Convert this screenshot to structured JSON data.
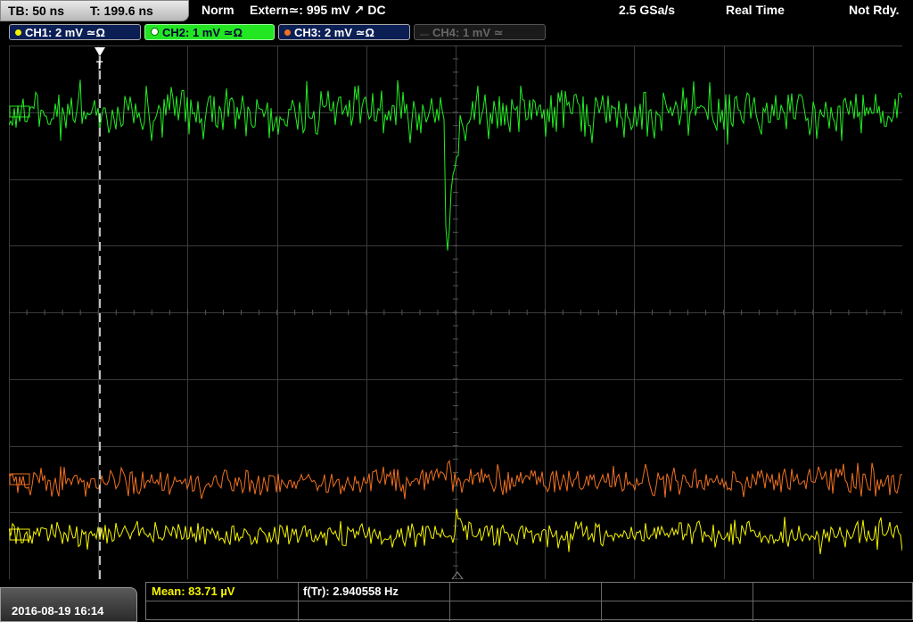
{
  "top": {
    "timebase": "TB: 50 ns",
    "trigger_time": "T: 199.6 ns",
    "mode": "Norm",
    "trigger_source": "Extern≃: 995 mV ↗ DC",
    "sample_rate": "2.5 GSa/s",
    "acq_mode": "Real Time",
    "status": "Not Rdy."
  },
  "channels": [
    {
      "label": "CH1: 2 mV ≃Ω",
      "color": "#f4f400"
    },
    {
      "label": "CH2: 1 mV ≃Ω",
      "color": "#22ee22"
    },
    {
      "label": "CH3: 2 mV ≃Ω",
      "color": "#f07020"
    },
    {
      "label": "CH4: 1 mV ≃",
      "color": "#666666"
    }
  ],
  "screen": {
    "trigger_marker": "T"
  },
  "bottom": {
    "datetime": "2016-08-19 16:14",
    "mean": "Mean: 83.71 µV",
    "freq": "f(Tr): 2.940558 Hz"
  },
  "colors": {
    "ch1": "#f4f400",
    "ch2": "#22ee22",
    "ch3": "#f07020",
    "grid": "#3a3a3a",
    "background": "#000000"
  }
}
